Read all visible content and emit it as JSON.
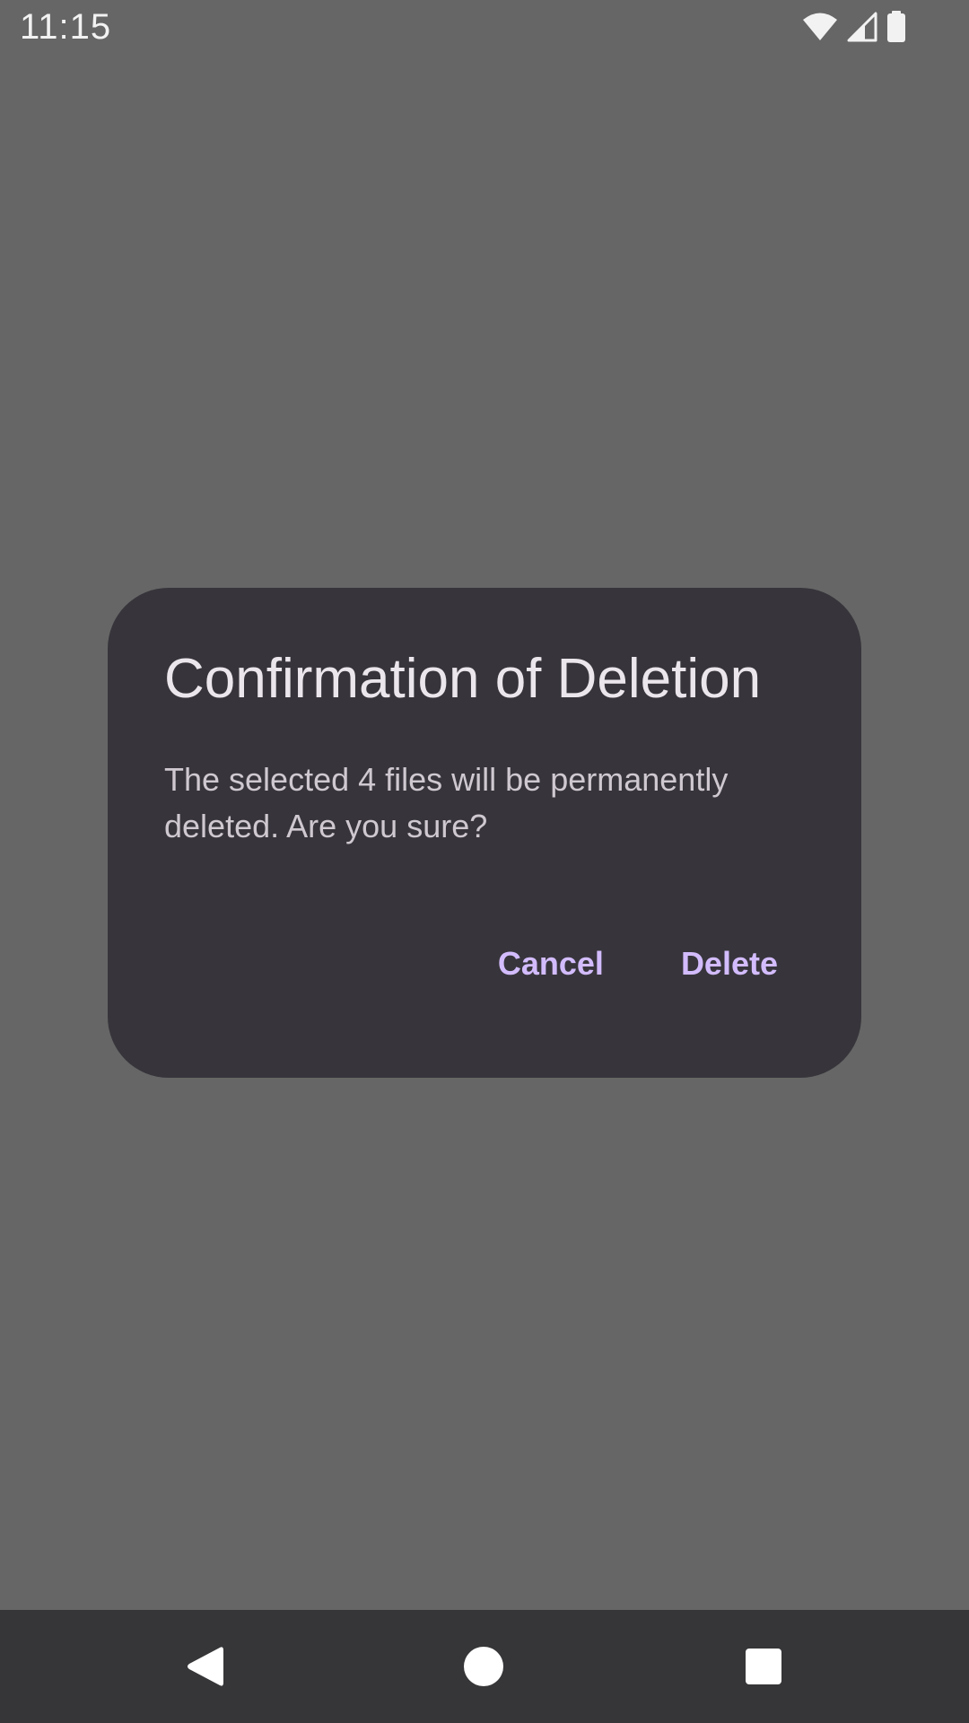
{
  "status_bar": {
    "time": "11:15",
    "icons": [
      "wifi-icon",
      "cellular-signal-icon",
      "battery-icon"
    ]
  },
  "dialog": {
    "title": "Confirmation of Deletion",
    "message": "The selected 4 files will be permanently deleted. Are you sure?",
    "cancel_label": "Cancel",
    "delete_label": "Delete"
  },
  "navigation_bar": {
    "buttons": [
      "back-icon",
      "home-icon",
      "recents-icon"
    ]
  },
  "colors": {
    "scrim": "#666666",
    "dialog_background": "#37353b",
    "accent": "#d3bcfd",
    "nav_bar": "#363638"
  }
}
